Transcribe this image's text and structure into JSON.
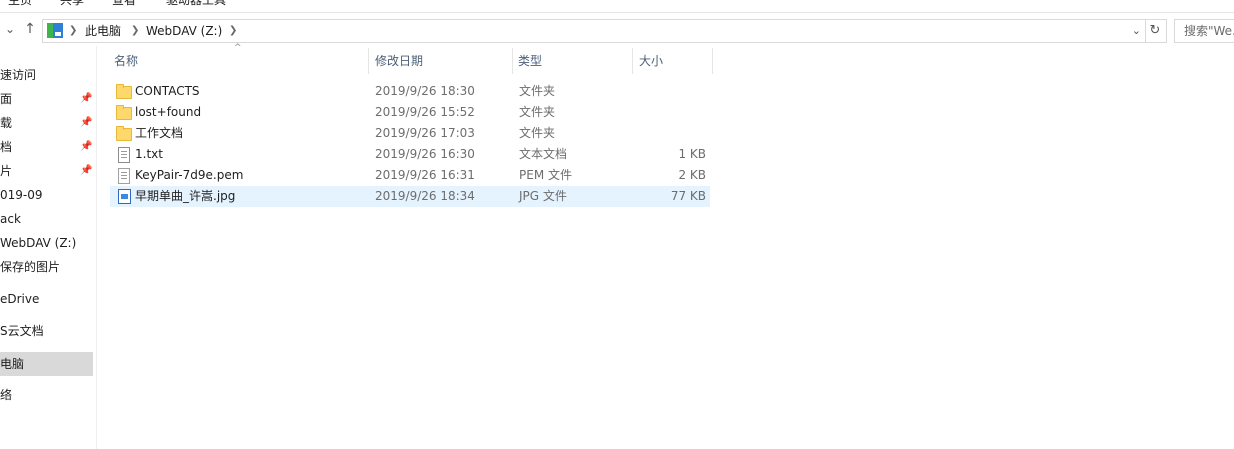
{
  "ribbon": {
    "tabs": [
      "主页",
      "共享",
      "查看",
      "驱动器工具"
    ]
  },
  "nav_buttons": {
    "up_label": "↑",
    "expand_label": "⌄"
  },
  "address": {
    "crumbs": [
      "此电脑",
      "WebDAV (Z:)"
    ],
    "dropdown_glyph": "⌄",
    "refresh_glyph": "↻"
  },
  "search": {
    "placeholder": "搜索\"We..."
  },
  "navpane": {
    "items": [
      {
        "label": "速访问",
        "pinned": false
      },
      {
        "label": "面",
        "pinned": true
      },
      {
        "label": "载",
        "pinned": true
      },
      {
        "label": "档",
        "pinned": true
      },
      {
        "label": "片",
        "pinned": true
      },
      {
        "label": "019-09",
        "pinned": false
      },
      {
        "label": "ack",
        "pinned": false
      },
      {
        "label": "WebDAV (Z:)",
        "pinned": false
      },
      {
        "label": "保存的图片",
        "pinned": false
      },
      {
        "label": "eDrive",
        "pinned": false
      },
      {
        "label": "S云文档",
        "pinned": false
      },
      {
        "label": "电脑",
        "pinned": false,
        "selected": true
      },
      {
        "label": "络",
        "pinned": false
      }
    ]
  },
  "columns": {
    "name": "名称",
    "date": "修改日期",
    "type": "类型",
    "size": "大小"
  },
  "files": [
    {
      "name": "CONTACTS",
      "date": "2019/9/26 18:30",
      "type": "文件夹",
      "size": "",
      "icon": "folder-icon"
    },
    {
      "name": "lost+found",
      "date": "2019/9/26 15:52",
      "type": "文件夹",
      "size": "",
      "icon": "folder-icon"
    },
    {
      "name": "工作文档",
      "date": "2019/9/26 17:03",
      "type": "文件夹",
      "size": "",
      "icon": "folder-icon"
    },
    {
      "name": "1.txt",
      "date": "2019/9/26 16:30",
      "type": "文本文档",
      "size": "1 KB",
      "icon": "text-file-icon"
    },
    {
      "name": "KeyPair-7d9e.pem",
      "date": "2019/9/26 16:31",
      "type": "PEM 文件",
      "size": "2 KB",
      "icon": "file-icon"
    },
    {
      "name": "早期单曲_许嵩.jpg",
      "date": "2019/9/26 18:34",
      "type": "JPG 文件",
      "size": "77 KB",
      "icon": "image-file-icon",
      "selected": true
    }
  ],
  "colors": {
    "selection": "#e5f3ff",
    "nav_selected": "#d9d9d9",
    "header_text": "#4c607a",
    "folder": "#ffd86b"
  }
}
